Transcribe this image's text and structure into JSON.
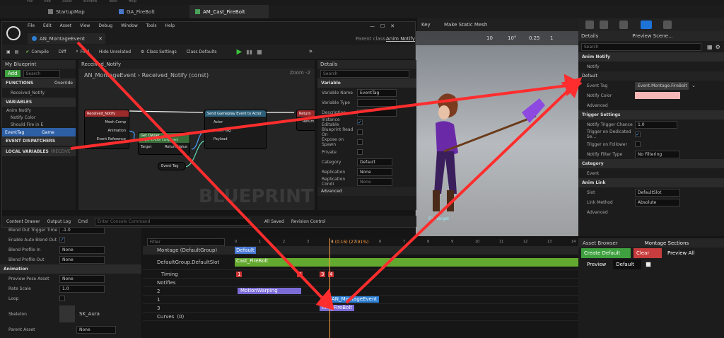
{
  "main_window": {
    "menu": [
      "File",
      "Edit",
      "Asset",
      "Window",
      "Tools",
      "Help"
    ],
    "tabs": [
      "StartupMap",
      "GA_FireBolt",
      "AM_Cast_FireBolt"
    ],
    "viewport_toolbar": {
      "key_label": "Key",
      "static_mesh_label": "Make Static Mesh",
      "fov": "10",
      "angle": "10°",
      "scale": "0.25",
      "cam_speed": "1"
    },
    "panel_tabs": {
      "details": "Details",
      "preview": "Preview Scene..."
    },
    "search_placeholder": "Search",
    "details": {
      "anim_notify_header": "Anim Notify",
      "notify_row": "Notify",
      "default_header": "Default",
      "event_tag_label": "Event Tag",
      "event_tag_value": "Event.Montage.FireBolt",
      "notify_color_label": "Notify Color",
      "notify_color": "#f4b6b6",
      "advanced": "Advanced",
      "trigger_settings": "Trigger Settings",
      "notify_trigger_chance_label": "Notify Trigger Chance",
      "notify_trigger_chance": "1.0",
      "trigger_dedicated_label": "Trigger on Dedicated Se...",
      "trigger_follower_label": "Trigger on Follower",
      "notify_filter_type_label": "Notify Filter Type",
      "notify_filter_type": "No Filtering",
      "category": "Category",
      "event": "Event",
      "anim_link": "Anim Link",
      "slot_label": "Slot",
      "slot_value": "DefaultSlot",
      "link_method_label": "Link Method",
      "link_method_value": "Absolute",
      "advanced2": "Advanced"
    },
    "bottom_right": {
      "asset_browser": "Asset Browser",
      "montage_sections": "Montage Sections",
      "create_default": "Create Default",
      "clear": "Clear",
      "preview_all": "Preview All",
      "preview": "Preview",
      "default": "Default"
    },
    "left_props": {
      "blend_out_trigger_time_label": "Blend Out Trigger Time",
      "blend_out_trigger_time": "-1.0",
      "enable_auto_blend_out": "Enable Auto Blend Out",
      "blend_profile_in_label": "Blend Profile In",
      "blend_profile_in": "None",
      "blend_profile_out_label": "Blend Profile Out",
      "blend_profile_out": "None",
      "animation_header": "Animation",
      "preview_pose_asset_label": "Preview Pose Asset",
      "preview_pose_asset": "None",
      "rate_scale_label": "Rate Scale",
      "rate_scale": "1.0",
      "loop_label": "Loop",
      "skeleton_label": "Skeleton",
      "skeleton_value": "SK_Aura",
      "parent_asset_label": "Parent Asset",
      "parent_asset_value": "None"
    },
    "timeline": {
      "filter_placeholder": "Filter",
      "frame_readout": "3 (0.16) (27.91%)",
      "tracks": {
        "montage": "Montage (DefaultGroup)",
        "default_group": "DefaultGroup.DefaultSlot",
        "timing": "Timing",
        "notifies": "Notifies",
        "n2": "2",
        "n1": "1",
        "n3": "3",
        "curves": "Curves",
        "curves_count": "(0)"
      },
      "section_default": "Default",
      "segment": "Cast_FireBolt",
      "timing_markers": [
        "1",
        "2",
        "3",
        "4"
      ],
      "notify_motion_warping": "MotionWarping",
      "notify_montage_event": "AN_MontageEvent",
      "notify_fire_bolt": "Info_FireBolt",
      "ticks": [
        "0",
        "1",
        "2",
        "3",
        "4",
        "5",
        "6",
        "7",
        "8",
        "9",
        "10",
        "11",
        "12",
        "13",
        "14"
      ]
    },
    "viewport": {
      "watermark": "",
      "target_label": "FireTarget"
    }
  },
  "bp_window": {
    "tab": "AN_MontageEvent",
    "parent_class_label": "Parent class:",
    "parent_class": "Anim Notify",
    "menu": [
      "File",
      "Edit",
      "Asset",
      "View",
      "Debug",
      "Window",
      "Tools",
      "Help"
    ],
    "toolbar": {
      "compile": "Compile",
      "diff": "Diff",
      "find": "Find",
      "hide_unrelated": "Hide Unrelated",
      "class_settings": "Class Settings",
      "class_defaults": "Class Defaults"
    },
    "my_blueprint": {
      "title": "My Blueprint",
      "add": "Add",
      "search": "Search",
      "functions": "FUNCTIONS",
      "override": "Override",
      "received_notify": "Received_Notify",
      "variables": "VARIABLES",
      "anim_notify": "Anim Notify",
      "notify_color": "Notify Color",
      "should_fire": "Should Fire in E",
      "event_tag": "EventTag",
      "event_tag_type": "Game",
      "event_dispatchers": "EVENT DISPATCHERS",
      "local_variables": "LOCAL VARIABLES",
      "local_scope": "(RECEIVE"
    },
    "graph": {
      "tab": "Received_Notify",
      "breadcrumb": "AN_MontageEvent › Received_Notify (const)",
      "zoom": "Zoom -2",
      "watermark": "BLUEPRINT",
      "node_entry": "Received_Notify",
      "pin_mesh_comp": "Mesh Comp",
      "pin_animation": "Animation",
      "pin_event_ref": "Event Reference",
      "node_get_owner": "Get Owner",
      "node_get_owner_sub": "Target is Actor Component",
      "pin_target": "Target",
      "pin_return": "Return Value",
      "node_send": "Send Gameplay Event to Actor",
      "pin_actor": "Actor",
      "pin_event_tag": "Event Tag",
      "pin_payload": "Payload",
      "node_return": "Return",
      "pin_return_value": "Return V",
      "node_var": "Event Tag"
    },
    "details": {
      "title": "Details",
      "search": "Search",
      "variable": "Variable",
      "var_name_label": "Variable Name",
      "var_name": "EventTag",
      "var_type_label": "Variable Type",
      "description_label": "Description",
      "instance_editable_label": "Instance Editable",
      "blueprint_readonly_label": "Blueprint Read On",
      "expose_spawn_label": "Expose on Spawn",
      "private_label": "Private",
      "category_label": "Category",
      "category_value": "Default",
      "replication_label": "Replication",
      "replication_value": "None",
      "replication_cond_label": "Replication Condi",
      "replication_cond_value": "None",
      "advanced": "Advanced"
    },
    "status": {
      "content_drawer": "Content Drawer",
      "output_log": "Output Log",
      "cmd": "Cmd",
      "console_placeholder": "Enter Console Command",
      "all_saved": "All Saved",
      "revision_control": "Revision Control"
    }
  },
  "colors": {
    "accent_blue": "#2d7fd3",
    "arrow_red": "#ff2d2d",
    "play_green": "#3fc23f",
    "notify_purple": "#7b6bd6",
    "track_green": "#64a92f"
  }
}
